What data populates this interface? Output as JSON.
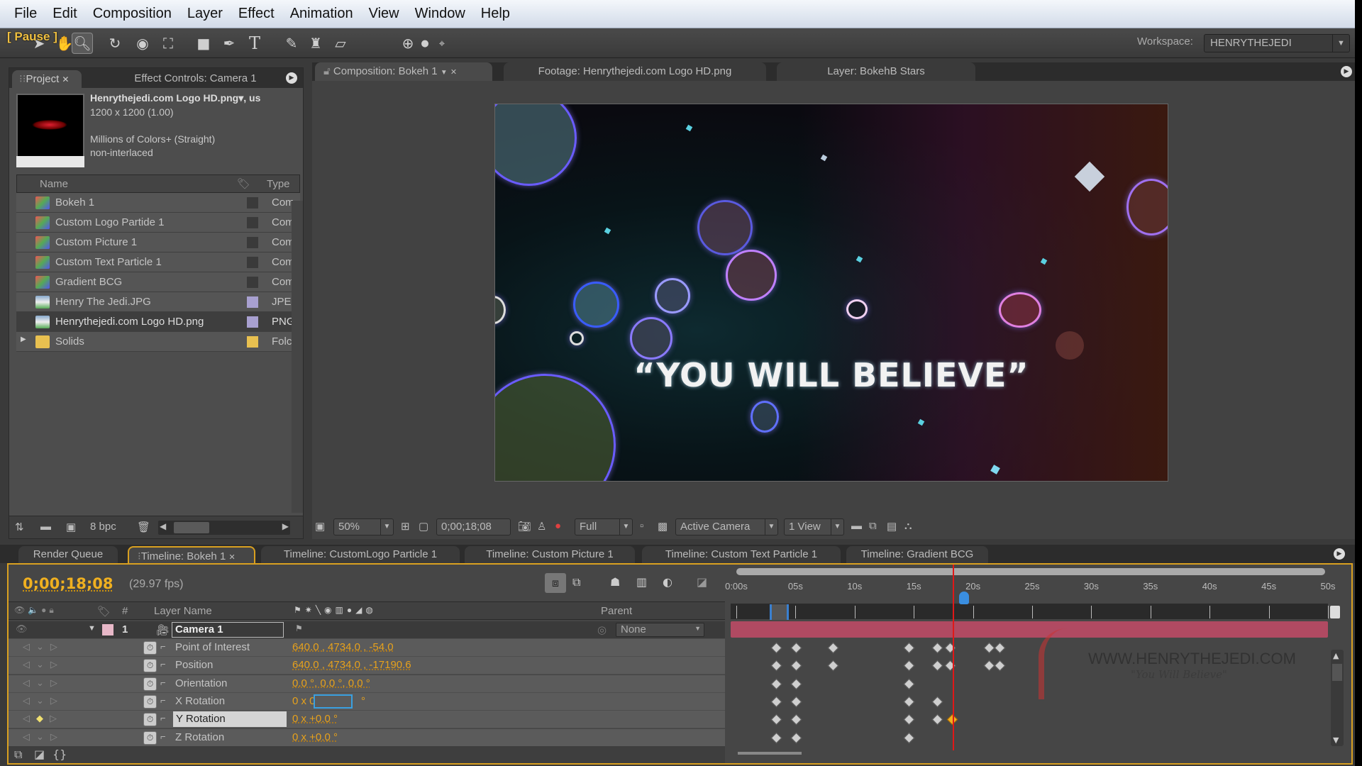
{
  "menubar": {
    "items": [
      "File",
      "Edit",
      "Composition",
      "Layer",
      "Effect",
      "Animation",
      "View",
      "Window",
      "Help"
    ]
  },
  "overlay": {
    "pause": "[ Pause ]"
  },
  "toolbar": {
    "tools": [
      "selection-tool",
      "hand-tool",
      "zoom-tool",
      "rotate-tool",
      "orbit-camera-tool",
      "pan-behind-tool",
      "rectangle-tool",
      "pen-tool",
      "type-tool",
      "brush-tool",
      "clone-stamp-tool",
      "eraser-tool",
      "local-axis-mode",
      "world-axis-mode",
      "view-axis-mode"
    ],
    "active_tool": "zoom-tool",
    "workspace_label": "Workspace:",
    "workspace_value": "HENRYTHEJEDI"
  },
  "project": {
    "tabs": [
      "Project",
      "Effect Controls: Camera 1"
    ],
    "selected_item": {
      "name": "Henrythejedi.com Logo HD.png",
      "suffix": "▾, us",
      "dims": "1200 x 1200 (1.00)",
      "colors": "Millions of Colors+ (Straight)",
      "interlace": "non-interlaced"
    },
    "columns": {
      "name": "Name",
      "type": "Type"
    },
    "items": [
      {
        "name": "Bokeh 1",
        "type": "Com",
        "kind": "comp",
        "label": "#3a3a3a"
      },
      {
        "name": "Custom Logo Partide 1",
        "type": "Com",
        "kind": "comp",
        "label": "#3a3a3a"
      },
      {
        "name": "Custom Picture 1",
        "type": "Com",
        "kind": "comp",
        "label": "#3a3a3a"
      },
      {
        "name": "Custom Text Particle 1",
        "type": "Com",
        "kind": "comp",
        "label": "#3a3a3a"
      },
      {
        "name": "Gradient BCG",
        "type": "Com",
        "kind": "comp",
        "label": "#3a3a3a"
      },
      {
        "name": "Henry The Jedi.JPG",
        "type": "JPEG",
        "kind": "image",
        "label": "#a8a0d0"
      },
      {
        "name": "Henrythejedi.com Logo HD.png",
        "type": "PNG",
        "kind": "image",
        "label": "#a8a0d0",
        "selected": true
      },
      {
        "name": "Solids",
        "type": "Folc",
        "kind": "folder",
        "label": "#e8c050"
      }
    ],
    "footer": {
      "bpc": "8 bpc"
    }
  },
  "comp": {
    "tabs": [
      "Composition: Bokeh 1",
      "Footage: Henrythejedi.com Logo HD.png",
      "Layer: BokehB Stars"
    ],
    "viewer_text": "“YOU WILL BELIEVE”",
    "controls": {
      "zoom": "50%",
      "timecode": "0;00;18;08",
      "resolution": "Full",
      "camera": "Active Camera",
      "views": "1 View"
    }
  },
  "timeline": {
    "tabs": [
      "Render Queue",
      "Timeline: Bokeh 1",
      "Timeline: CustomLogo Particle 1",
      "Timeline: Custom Picture 1",
      "Timeline: Custom Text Particle 1",
      "Timeline: Gradient BCG"
    ],
    "active_tab": 1,
    "timecode": "0;00;18;08",
    "fps": "(29.97 fps)",
    "columns": {
      "num": "#",
      "layer_name": "Layer Name",
      "parent": "Parent"
    },
    "layer": {
      "index": "1",
      "name": "Camera 1",
      "parent": "None",
      "color": "#e8b8c8"
    },
    "properties": [
      {
        "name": "Point of Interest",
        "value": "640.0 , 4734.0 , -54.0",
        "keyframes": [
          3.4,
          5.1,
          8.2,
          14.6,
          17,
          18.1,
          21.4,
          22.3
        ]
      },
      {
        "name": "Position",
        "value": "640.0 , 4734.0 , -17190.6",
        "keyframes": [
          3.4,
          5.1,
          8.2,
          14.6,
          17,
          18.1,
          21.4,
          22.3
        ]
      },
      {
        "name": "Orientation",
        "value": "0.0 °, 0.0 °, 0.0 °",
        "keyframes": [
          3.4,
          5.1,
          14.6
        ]
      },
      {
        "name": "X Rotation",
        "value": "0 x 0",
        "editing": true,
        "unit": "°",
        "keyframes": [
          3.4,
          5.1,
          14.6,
          17
        ]
      },
      {
        "name": "Y Rotation",
        "value": "0 x +0.0 °",
        "selected": true,
        "keyframes": [
          3.4,
          5.1,
          14.6,
          17,
          18.27
        ]
      },
      {
        "name": "Z Rotation",
        "value": "0 x +0.0 °",
        "keyframes": [
          3.4,
          5.1,
          14.6
        ]
      }
    ],
    "ruler": {
      "labels": [
        "0:00s",
        "05s",
        "10s",
        "15s",
        "20s",
        "25s",
        "30s",
        "35s",
        "40s",
        "45s",
        "50s"
      ],
      "max_seconds": 50,
      "current_seconds": 18.27
    },
    "watermark": {
      "title": "WWW.HENRYTHEJEDI.COM",
      "subtitle": "\"You Will Believe\""
    }
  }
}
